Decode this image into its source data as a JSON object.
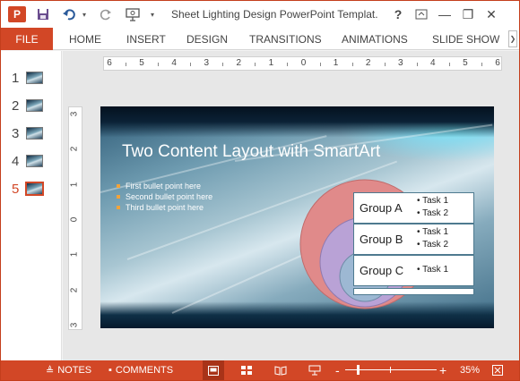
{
  "window": {
    "app_icon_letter": "P",
    "title": "Sheet Lighting Design PowerPoint Templat...",
    "help_label": "?",
    "minimize_label": "—",
    "restore_label": "❐",
    "close_label": "✕"
  },
  "ribbon": {
    "file_label": "FILE",
    "tabs": [
      "HOME",
      "INSERT",
      "DESIGN",
      "TRANSITIONS",
      "ANIMATIONS",
      "SLIDE SHOW"
    ],
    "collapse_label": "❯"
  },
  "thumbnails": {
    "numbers": [
      "1",
      "2",
      "3",
      "4",
      "5"
    ],
    "active_index": 4
  },
  "ruler": {
    "horizontal": [
      "6",
      "5",
      "4",
      "3",
      "2",
      "1",
      "0",
      "1",
      "2",
      "3",
      "4",
      "5",
      "6"
    ],
    "vertical": [
      "3",
      "2",
      "1",
      "0",
      "1",
      "2",
      "3"
    ]
  },
  "slide": {
    "title": "Two Content Layout with SmartArt",
    "bullets": [
      "First bullet point here",
      "Second bullet point here",
      "Third bullet point here"
    ],
    "groups": [
      {
        "label": "Group A",
        "tasks": [
          "• Task 1",
          "• Task 2"
        ]
      },
      {
        "label": "Group B",
        "tasks": [
          "• Task 1",
          "• Task 2"
        ]
      },
      {
        "label": "Group C",
        "tasks": [
          "• Task 1"
        ]
      }
    ]
  },
  "statusbar": {
    "notes_label": "NOTES",
    "comments_label": "COMMENTS",
    "zoom_minus": "-",
    "zoom_plus": "+",
    "zoom_value": "35%",
    "zoom_level": 0.35
  },
  "colors": {
    "accent": "#d24726",
    "bullet": "#f2a33a",
    "circle_outer": "#e08a8a",
    "circle_middle": "#b9a2d6",
    "circle_inner": "#9db8d3"
  }
}
